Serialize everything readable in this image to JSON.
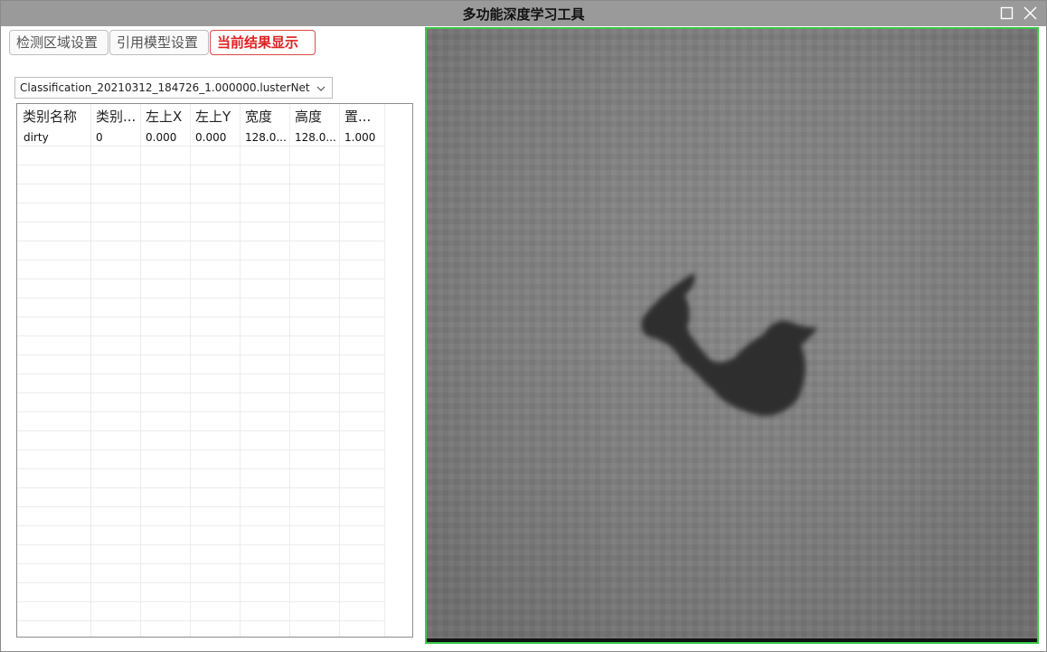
{
  "window": {
    "title": "多功能深度学习工具"
  },
  "tabs": [
    {
      "label": "检测区域设置"
    },
    {
      "label": "引用模型设置"
    },
    {
      "label": "当前结果显示"
    }
  ],
  "model_select": {
    "value": "Classification_20210312_184726_1.000000.lusterNet"
  },
  "results_table": {
    "headers": [
      "类别名称",
      "类别...",
      "左上X",
      "左上Y",
      "宽度",
      "高度",
      "置..."
    ],
    "rows": [
      [
        "dirty",
        "0",
        "0.000",
        "0.000",
        "128.0...",
        "128.0...",
        "1.000"
      ]
    ]
  },
  "colors": {
    "titlebar": "#9a9a9a",
    "active_tab": "#e02020",
    "viewer_border": "#3cc84a"
  },
  "icons": {
    "maximize": "square-outline",
    "close": "x-cross",
    "dropdown": "chevron-down"
  }
}
